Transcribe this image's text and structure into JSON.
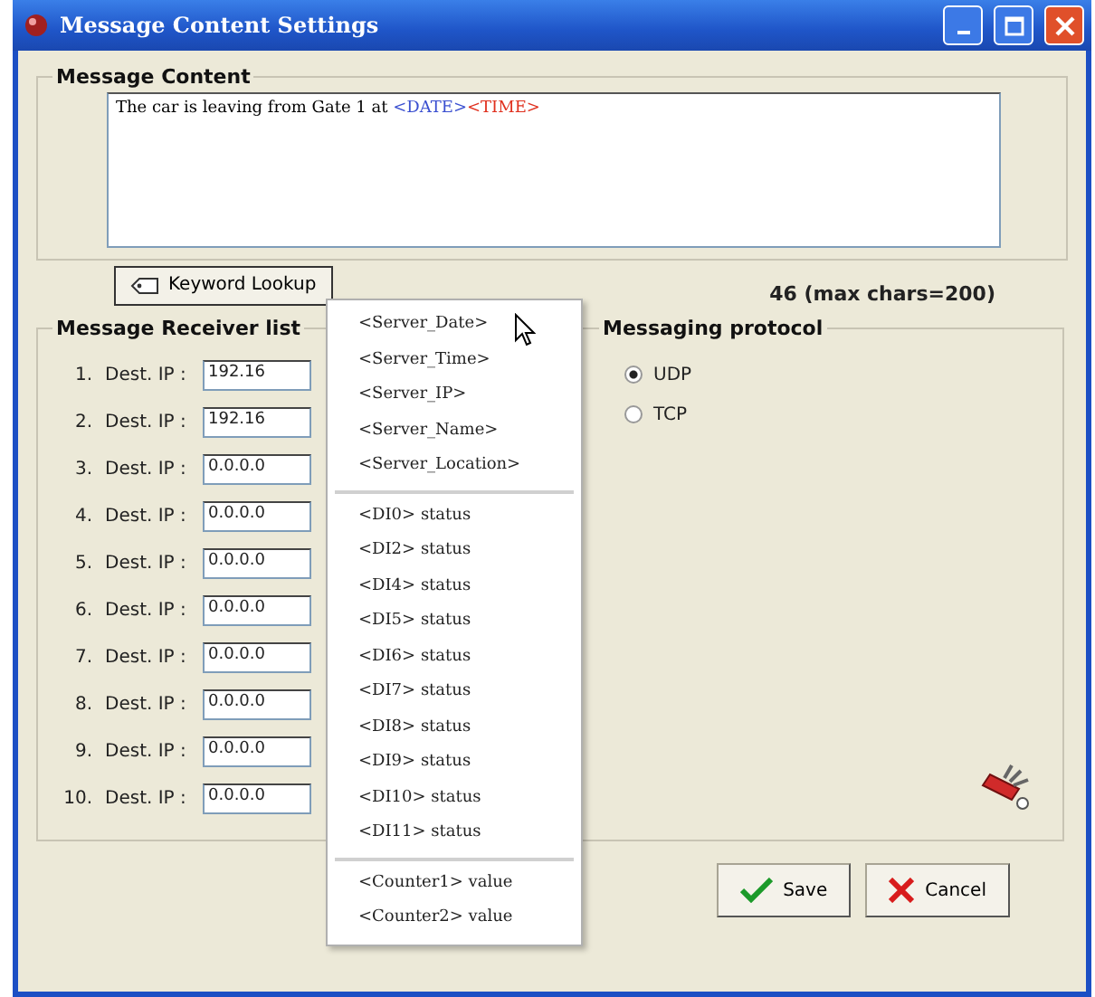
{
  "window": {
    "title": "Message Content Settings"
  },
  "message_content": {
    "title": "Message Content",
    "segments": [
      {
        "text": "The car is leaving from Gate 1 at ",
        "color": "#000000"
      },
      {
        "text": "<DATE>",
        "color": "#3a4fd0"
      },
      {
        "text": "<TIME>",
        "color": "#e0301e"
      }
    ],
    "keyword_button": "Keyword Lookup",
    "char_count": "46 (max chars=200)"
  },
  "receiver_list": {
    "title": "Message Receiver list",
    "rows": [
      {
        "index": "1.",
        "label": "Dest. IP :",
        "value": "192.16"
      },
      {
        "index": "2.",
        "label": "Dest. IP :",
        "value": "192.16"
      },
      {
        "index": "3.",
        "label": "Dest. IP :",
        "value": "0.0.0.0"
      },
      {
        "index": "4.",
        "label": "Dest. IP :",
        "value": "0.0.0.0"
      },
      {
        "index": "5.",
        "label": "Dest. IP :",
        "value": "0.0.0.0"
      },
      {
        "index": "6.",
        "label": "Dest. IP :",
        "value": "0.0.0.0"
      },
      {
        "index": "7.",
        "label": "Dest. IP :",
        "value": "0.0.0.0"
      },
      {
        "index": "8.",
        "label": "Dest. IP :",
        "value": "0.0.0.0"
      },
      {
        "index": "9.",
        "label": "Dest. IP :",
        "value": "0.0.0.0"
      },
      {
        "index": "10.",
        "label": "Dest. IP :",
        "value": "0.0.0.0"
      }
    ]
  },
  "messaging_protocol": {
    "title": "Messaging protocol",
    "options": [
      {
        "label": "UDP",
        "selected": true
      },
      {
        "label": "TCP",
        "selected": false
      }
    ]
  },
  "keyword_menu": {
    "groups": [
      [
        "<Server_Date>",
        "<Server_Time>",
        "<Server_IP>",
        "<Server_Name>",
        "<Server_Location>"
      ],
      [
        "<DI0> status",
        "<DI2> status",
        "<DI4> status",
        "<DI5> status",
        "<DI6> status",
        "<DI7> status",
        "<DI8> status",
        "<DI9> status",
        "<DI10> status",
        "<DI11> status"
      ],
      [
        "<Counter1> value",
        "<Counter2> value"
      ]
    ]
  },
  "buttons": [
    {
      "kind": "save",
      "label": "Save"
    },
    {
      "kind": "cancel",
      "label": "Cancel"
    }
  ]
}
